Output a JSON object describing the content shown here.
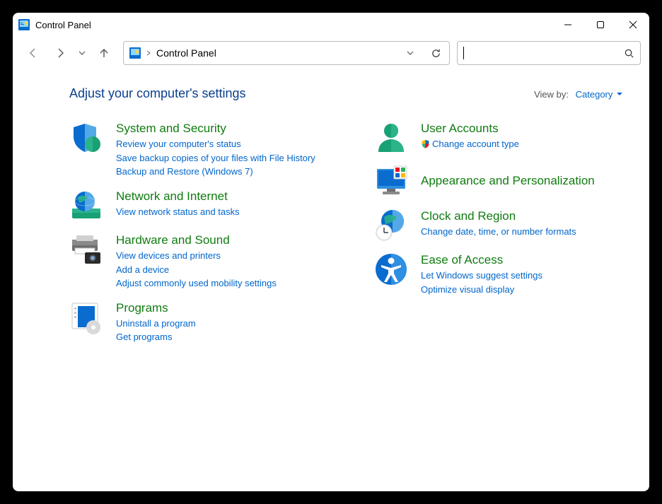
{
  "window": {
    "title": "Control Panel"
  },
  "address": {
    "crumb": "Control Panel"
  },
  "search": {
    "placeholder": ""
  },
  "header": {
    "heading": "Adjust your computer's settings",
    "viewby_label": "View by:",
    "viewby_value": "Category"
  },
  "categories": {
    "left": [
      {
        "title": "System and Security",
        "links": [
          "Review your computer's status",
          "Save backup copies of your files with File History",
          "Backup and Restore (Windows 7)"
        ]
      },
      {
        "title": "Network and Internet",
        "links": [
          "View network status and tasks"
        ]
      },
      {
        "title": "Hardware and Sound",
        "links": [
          "View devices and printers",
          "Add a device",
          "Adjust commonly used mobility settings"
        ]
      },
      {
        "title": "Programs",
        "links": [
          "Uninstall a program",
          "Get programs"
        ]
      }
    ],
    "right": [
      {
        "title": "User Accounts",
        "links": [
          "Change account type"
        ],
        "shield_on_first": true
      },
      {
        "title": "Appearance and Personalization",
        "links": []
      },
      {
        "title": "Clock and Region",
        "links": [
          "Change date, time, or number formats"
        ]
      },
      {
        "title": "Ease of Access",
        "links": [
          "Let Windows suggest settings",
          "Optimize visual display"
        ]
      }
    ]
  }
}
